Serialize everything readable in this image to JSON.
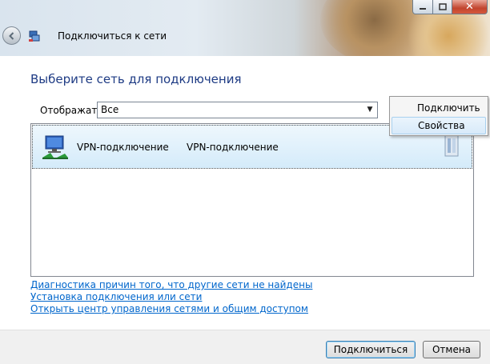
{
  "window": {
    "title": "Подключиться к сети",
    "close_glyph": "✕"
  },
  "page": {
    "heading": "Выберите сеть для подключения"
  },
  "filter": {
    "label": "Отображать",
    "selected": "Все"
  },
  "networks": [
    {
      "name": "VPN-подключение",
      "type": "VPN-подключение",
      "icon": "vpn-network-icon"
    }
  ],
  "context_menu": {
    "items": [
      "Подключить",
      "Свойства"
    ],
    "highlighted": "Свойства"
  },
  "links": [
    "Диагностика причин того, что другие сети не найдены",
    "Установка подключения или сети",
    "Открыть центр управления сетями и общим доступом"
  ],
  "buttons": {
    "connect": "Подключиться",
    "cancel": "Отмена"
  },
  "colors": {
    "heading": "#1e3b84",
    "link": "#0066cc",
    "selection": "#d4ebfa"
  }
}
